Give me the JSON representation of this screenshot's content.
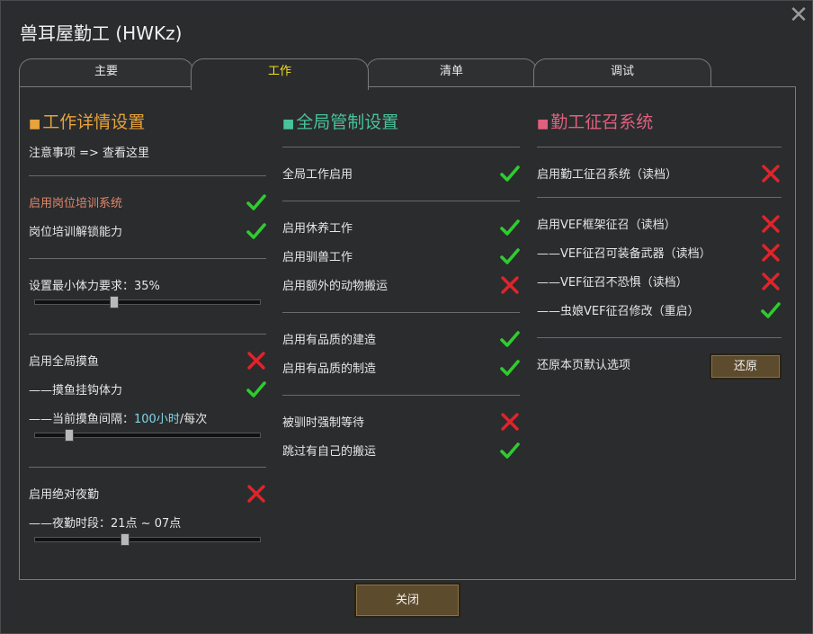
{
  "window": {
    "title": "兽耳屋勤工 (HWKz)"
  },
  "tabs": [
    {
      "label": "主要",
      "active": false
    },
    {
      "label": "工作",
      "active": true
    },
    {
      "label": "清单",
      "active": false
    },
    {
      "label": "调试",
      "active": false
    }
  ],
  "colors": {
    "heading1": "#e8a33a",
    "heading2": "#47c39a",
    "heading3": "#e0607e",
    "check": "#2ecc2e",
    "cross": "#e0242a",
    "active_tab": "#f5e21e"
  },
  "col1": {
    "heading": "工作详情设置",
    "note": "注意事项 => 查看这里",
    "training_system": {
      "label": "启用岗位培训系统",
      "enabled": true
    },
    "training_unlock": {
      "label": "岗位培训解锁能力",
      "enabled": true
    },
    "min_stamina": {
      "label": "设置最小体力要求：35%",
      "value_percent": 35
    },
    "global_slack": {
      "label": "启用全局摸鱼",
      "enabled": false
    },
    "slack_hook": {
      "label": "——摸鱼挂钩体力",
      "enabled": true
    },
    "slack_interval": {
      "prefix": "——当前摸鱼间隔：",
      "value": "100小时",
      "suffix": "/每次",
      "slider_fraction": 0.15
    },
    "night_shift": {
      "label": "启用绝对夜勤",
      "enabled": false
    },
    "night_period": {
      "label": "——夜勤时段：21点 ~ 07点",
      "slider_fraction": 0.4
    }
  },
  "col2": {
    "heading": "全局管制设置",
    "global_work": {
      "label": "全局工作启用",
      "enabled": true
    },
    "leisure_work": {
      "label": "启用休养工作",
      "enabled": true
    },
    "taming_work": {
      "label": "启用驯兽工作",
      "enabled": true
    },
    "extra_animal_haul": {
      "label": "启用额外的动物搬运",
      "enabled": false
    },
    "quality_construct": {
      "label": "启用有品质的建造",
      "enabled": true
    },
    "quality_craft": {
      "label": "启用有品质的制造",
      "enabled": true
    },
    "forced_wait": {
      "label": "被驯时强制等待",
      "enabled": false
    },
    "skip_own_haul": {
      "label": "跳过有自己的搬运",
      "enabled": true
    }
  },
  "col3": {
    "heading": "勤工征召系统",
    "draft_system": {
      "label": "启用勤工征召系统（读档）",
      "enabled": false
    },
    "vef_draft": {
      "label": "启用VEF框架征召（读档）",
      "enabled": false
    },
    "vef_weapons": {
      "label": "——VEF征召可装备武器（读档）",
      "enabled": false
    },
    "vef_fearless": {
      "label": "——VEF征召不恐惧（读档）",
      "enabled": false
    },
    "insect_vef": {
      "label": "——虫娘VEF征召修改（重启）",
      "enabled": true
    },
    "reset_label": "还原本页默认选项",
    "reset_button": "还原"
  },
  "footer": {
    "close_button": "关闭"
  }
}
